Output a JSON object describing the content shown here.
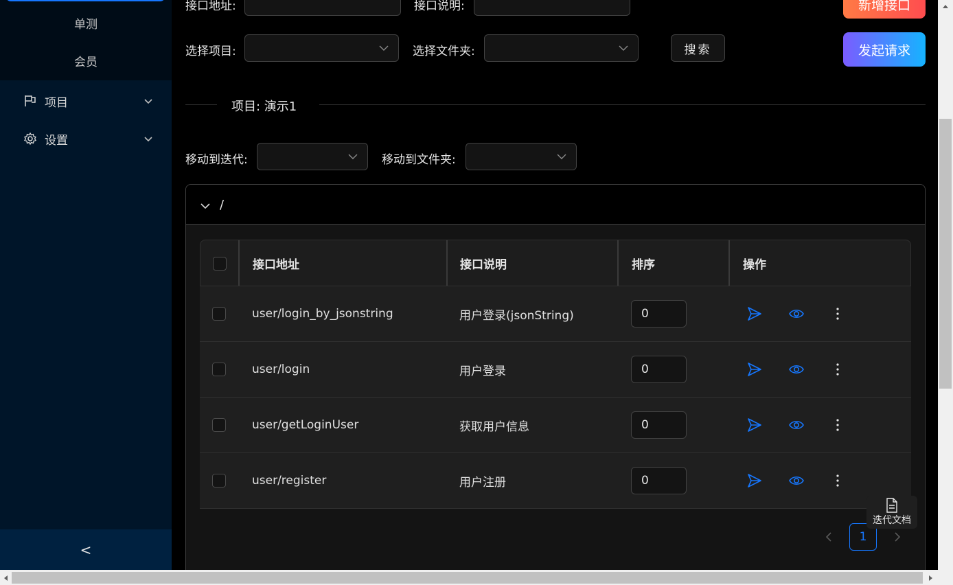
{
  "sidebar": {
    "sub_items": [
      "单测",
      "会员"
    ],
    "items": [
      {
        "label": "项目",
        "icon": "flag-icon"
      },
      {
        "label": "设置",
        "icon": "gear-icon"
      }
    ],
    "collapse_glyph": "<"
  },
  "filters": {
    "api_address_label": "接口地址:",
    "api_desc_label": "接口说明:",
    "select_project_label": "选择项目:",
    "select_folder_label": "选择文件夹:",
    "search_button": "搜索",
    "new_api_button": "新增接口",
    "send_request_button": "发起请求"
  },
  "project": {
    "divider_title": "项目: 演示1",
    "move_iteration_label": "移动到迭代:",
    "move_folder_label": "移动到文件夹:",
    "folder_path": "/"
  },
  "table": {
    "headers": {
      "address": "接口地址",
      "desc": "接口说明",
      "order": "排序",
      "actions": "操作"
    },
    "rows": [
      {
        "address": "user/login_by_jsonstring",
        "desc": "用户登录(jsonString)",
        "order": "0"
      },
      {
        "address": "user/login",
        "desc": "用户登录",
        "order": "0"
      },
      {
        "address": "user/getLoginUser",
        "desc": "获取用户信息",
        "order": "0"
      },
      {
        "address": "user/register",
        "desc": "用户注册",
        "order": "0"
      }
    ]
  },
  "pagination": {
    "current": "1"
  },
  "float_button": {
    "label": "迭代文档"
  },
  "colors": {
    "accent": "#1677ff",
    "sidebar_bg": "#001529",
    "grad_from": "#7a5cff",
    "grad_to": "#16b3ff"
  }
}
